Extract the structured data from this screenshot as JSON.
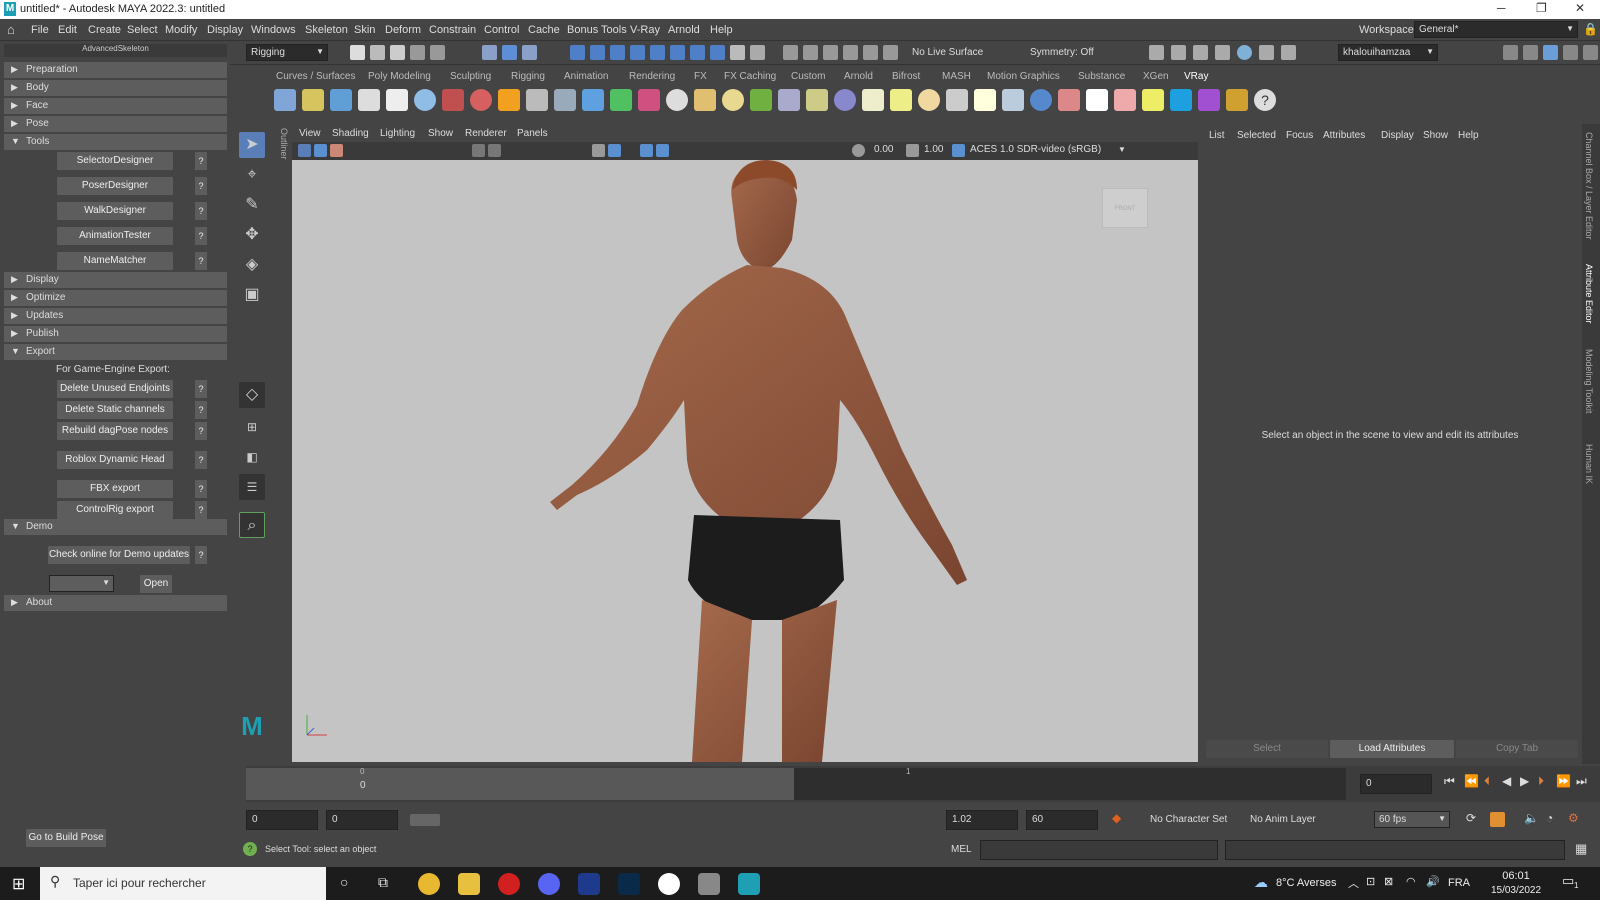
{
  "window": {
    "title": "untitled* - Autodesk MAYA 2022.3: untitled",
    "logo": "M"
  },
  "menu": [
    "File",
    "Edit",
    "Create",
    "Select",
    "Modify",
    "Display",
    "Windows",
    "Skeleton",
    "Skin",
    "Deform",
    "Constrain",
    "Control",
    "Cache",
    "Bonus Tools",
    "V-Ray",
    "Arnold",
    "Help"
  ],
  "workspace": {
    "label": "Workspace:",
    "value": "General*"
  },
  "status": {
    "mode": "Rigging",
    "live_surface": "No Live Surface",
    "symmetry": "Symmetry: Off",
    "user": "khalouihamzaa"
  },
  "panel": {
    "title": "AdvancedSkeleton",
    "sections_top": [
      "Preparation",
      "Body",
      "Face",
      "Pose"
    ],
    "tools_label": "Tools",
    "tools": [
      "SelectorDesigner",
      "PoserDesigner",
      "WalkDesigner",
      "AnimationTester",
      "NameMatcher"
    ],
    "sections_mid": [
      "Display",
      "Optimize",
      "Updates",
      "Publish"
    ],
    "export_label": "Export",
    "export_note": "For Game-Engine Export:",
    "export_buttons": [
      "Delete Unused Endjoints",
      "Delete Static channels",
      "Rebuild dagPose nodes",
      "Roblox Dynamic Head",
      "FBX export",
      "ControlRig export"
    ],
    "demo_label": "Demo",
    "demo_button": "Check online for Demo updates",
    "open_button": "Open",
    "about_label": "About",
    "build_pose": "Go to Build Pose",
    "help_mark": "?"
  },
  "shelf_tabs": [
    "Curves / Surfaces",
    "Poly Modeling",
    "Sculpting",
    "Rigging",
    "Animation",
    "Rendering",
    "FX",
    "FX Caching",
    "Custom",
    "Arnold",
    "Bifrost",
    "MASH",
    "Motion Graphics",
    "Substance",
    "XGen",
    "VRay"
  ],
  "viewport": {
    "menu": [
      "View",
      "Shading",
      "Lighting",
      "Show",
      "Renderer",
      "Panels"
    ],
    "exposure": "0.00",
    "gamma": "1.00",
    "colorspace": "ACES 1.0 SDR-video (sRGB)",
    "outliner_tab": "Outliner",
    "cube_label": "FRONT"
  },
  "attr_editor": {
    "menu": [
      "List",
      "Selected",
      "Focus",
      "Attributes",
      "Display",
      "Show",
      "Help"
    ],
    "message": "Select an object in the scene to view and edit its attributes",
    "buttons": [
      "Select",
      "Load Attributes",
      "Copy Tab"
    ]
  },
  "side_tabs": [
    "Channel Box / Layer Editor",
    "Attribute Editor",
    "Modeling Toolkit",
    "Human IK"
  ],
  "timeline": {
    "tick0": "0",
    "tick1": "1",
    "current": "0",
    "frame": "0"
  },
  "range": {
    "start": "0",
    "start2": "0",
    "end": "1.02",
    "end2": "60",
    "char_set": "No Character Set",
    "anim_layer": "No Anim Layer",
    "fps": "60 fps"
  },
  "cmd": {
    "help": "Select Tool: select an object",
    "lang": "MEL"
  },
  "taskbar": {
    "search": "Taper ici pour rechercher",
    "weather": "8°C  Averses",
    "lang": "FRA",
    "time": "06:01",
    "date": "15/03/2022",
    "notif": "1"
  }
}
